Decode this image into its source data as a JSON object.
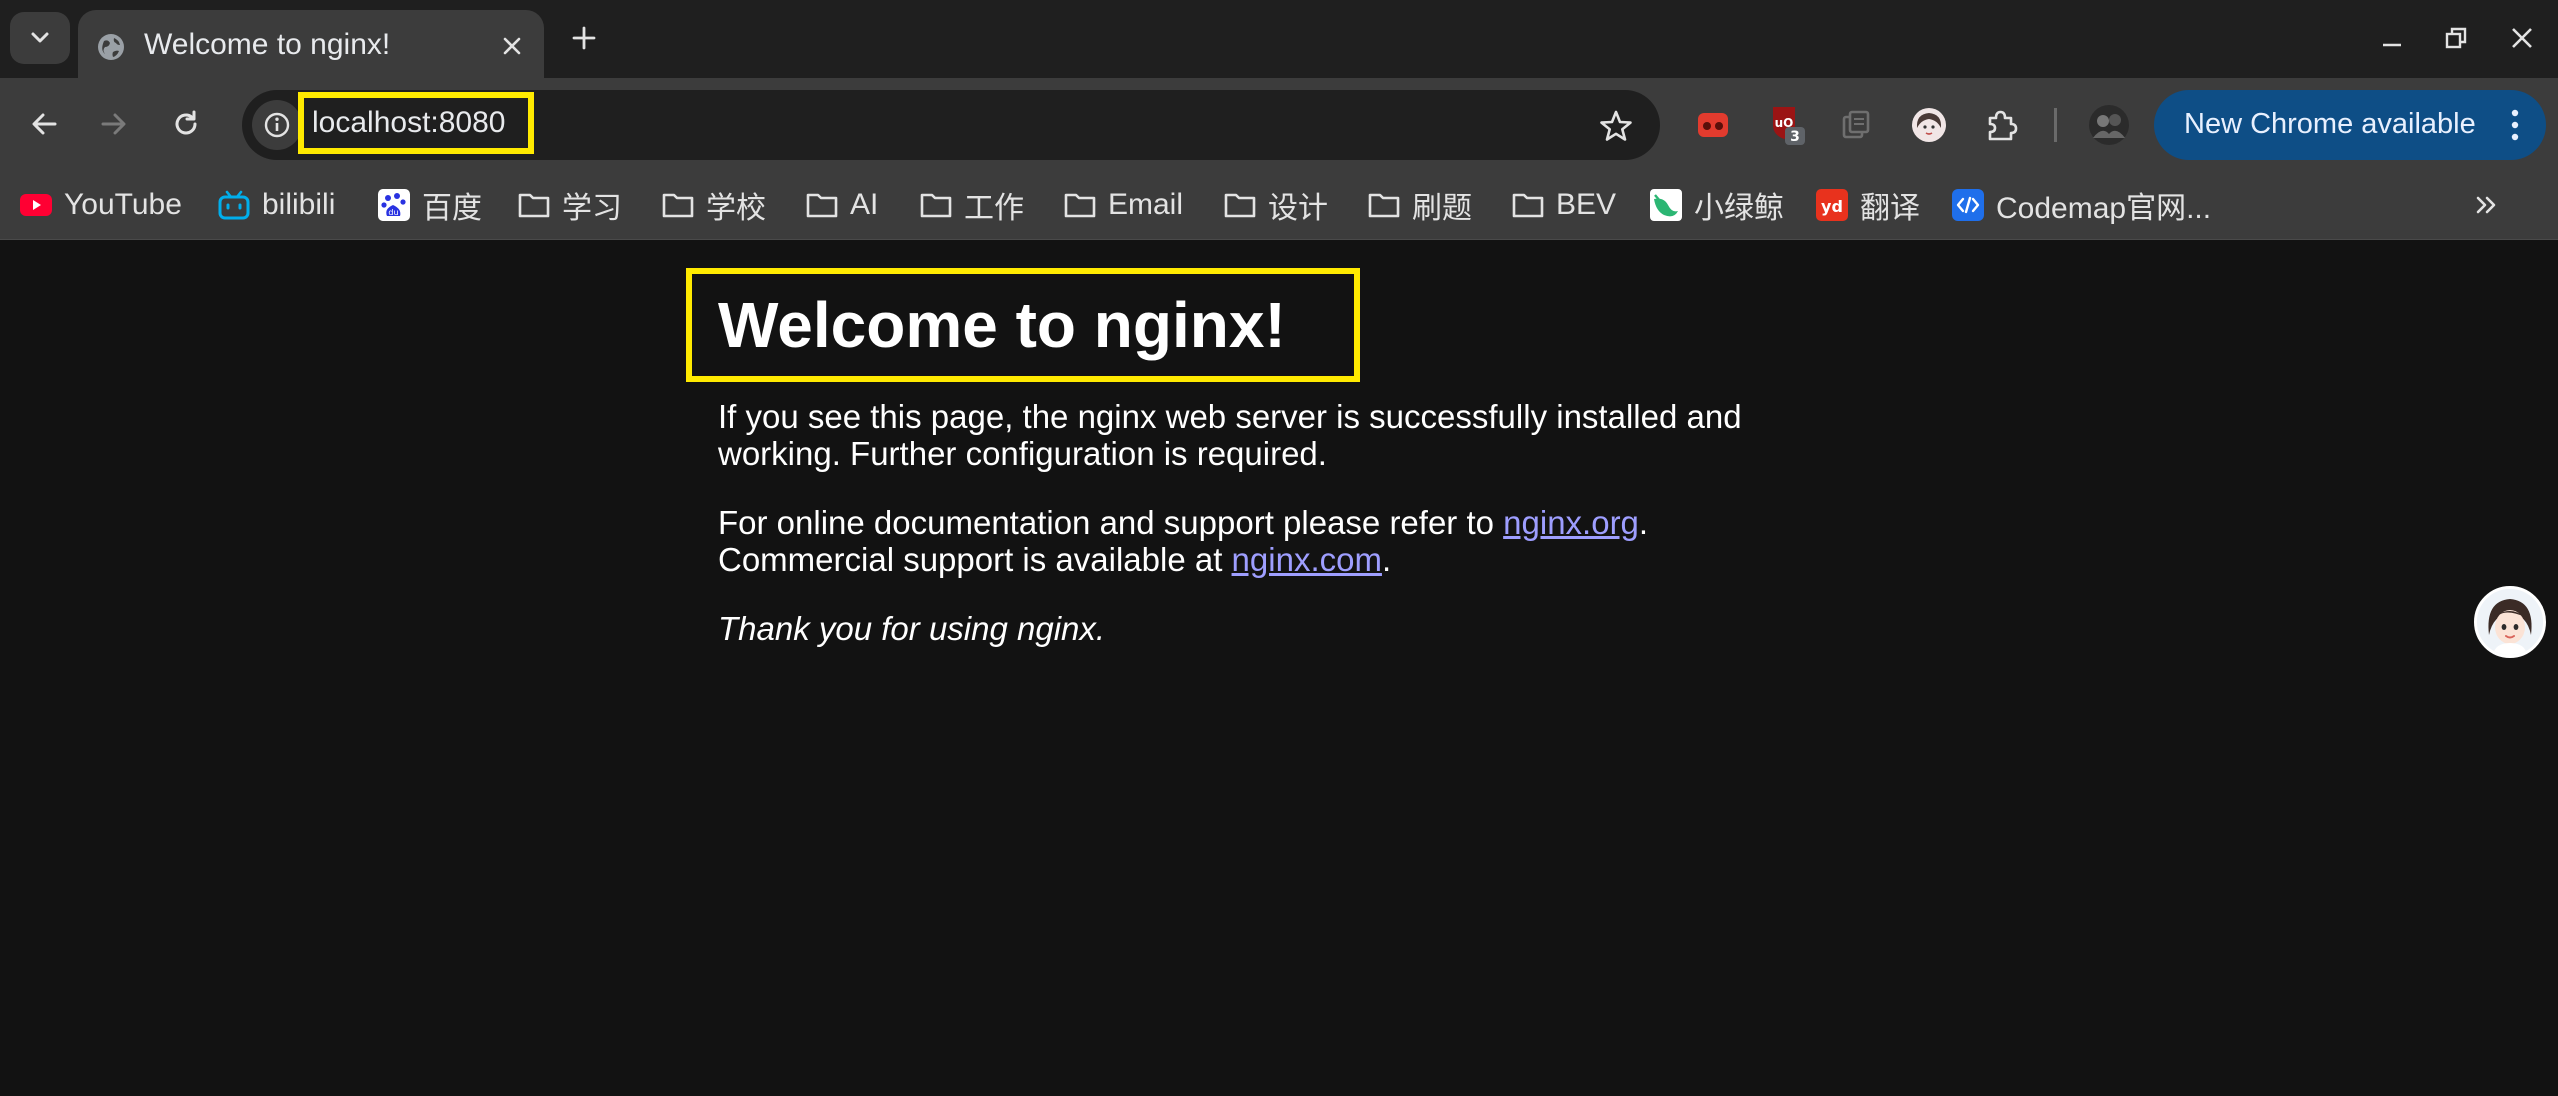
{
  "tab": {
    "title": "Welcome to nginx!"
  },
  "omnibox": {
    "url": "localhost:8080"
  },
  "toolbar": {
    "update_label": "New Chrome available",
    "ublock_badge": "3"
  },
  "bookmarks": [
    {
      "label": "YouTube",
      "icon": "youtube-icon"
    },
    {
      "label": "bilibili",
      "icon": "bilibili-icon"
    },
    {
      "label": "百度",
      "icon": "baidu-icon"
    },
    {
      "label": "学习",
      "icon": "folder-icon"
    },
    {
      "label": "学校",
      "icon": "folder-icon"
    },
    {
      "label": "AI",
      "icon": "folder-icon"
    },
    {
      "label": "工作",
      "icon": "folder-icon"
    },
    {
      "label": "Email",
      "icon": "folder-icon"
    },
    {
      "label": "设计",
      "icon": "folder-icon"
    },
    {
      "label": "刷题",
      "icon": "folder-icon"
    },
    {
      "label": "BEV",
      "icon": "folder-icon"
    },
    {
      "label": "小绿鲸",
      "icon": "xiaolvjing-icon"
    },
    {
      "label": "翻译",
      "icon": "youdao-icon"
    },
    {
      "label": "Codemap官网...",
      "icon": "codemap-icon"
    }
  ],
  "page": {
    "heading": "Welcome to nginx!",
    "p1_line1": "If you see this page, the nginx web server is successfully installed and",
    "p1_line2": "working. Further configuration is required.",
    "p2_line1_prefix": "For online documentation and support please refer to ",
    "p2_link1": "nginx.org",
    "p2_line1_suffix": ".",
    "p2_line2_prefix": "Commercial support is available at ",
    "p2_link2": "nginx.com",
    "p2_line2_suffix": ".",
    "p3": "Thank you for using nginx."
  },
  "colors": {
    "highlight": "#ffea00",
    "link": "#9e9eff",
    "update_button": "#0e4e86",
    "page_background": "#121212"
  }
}
